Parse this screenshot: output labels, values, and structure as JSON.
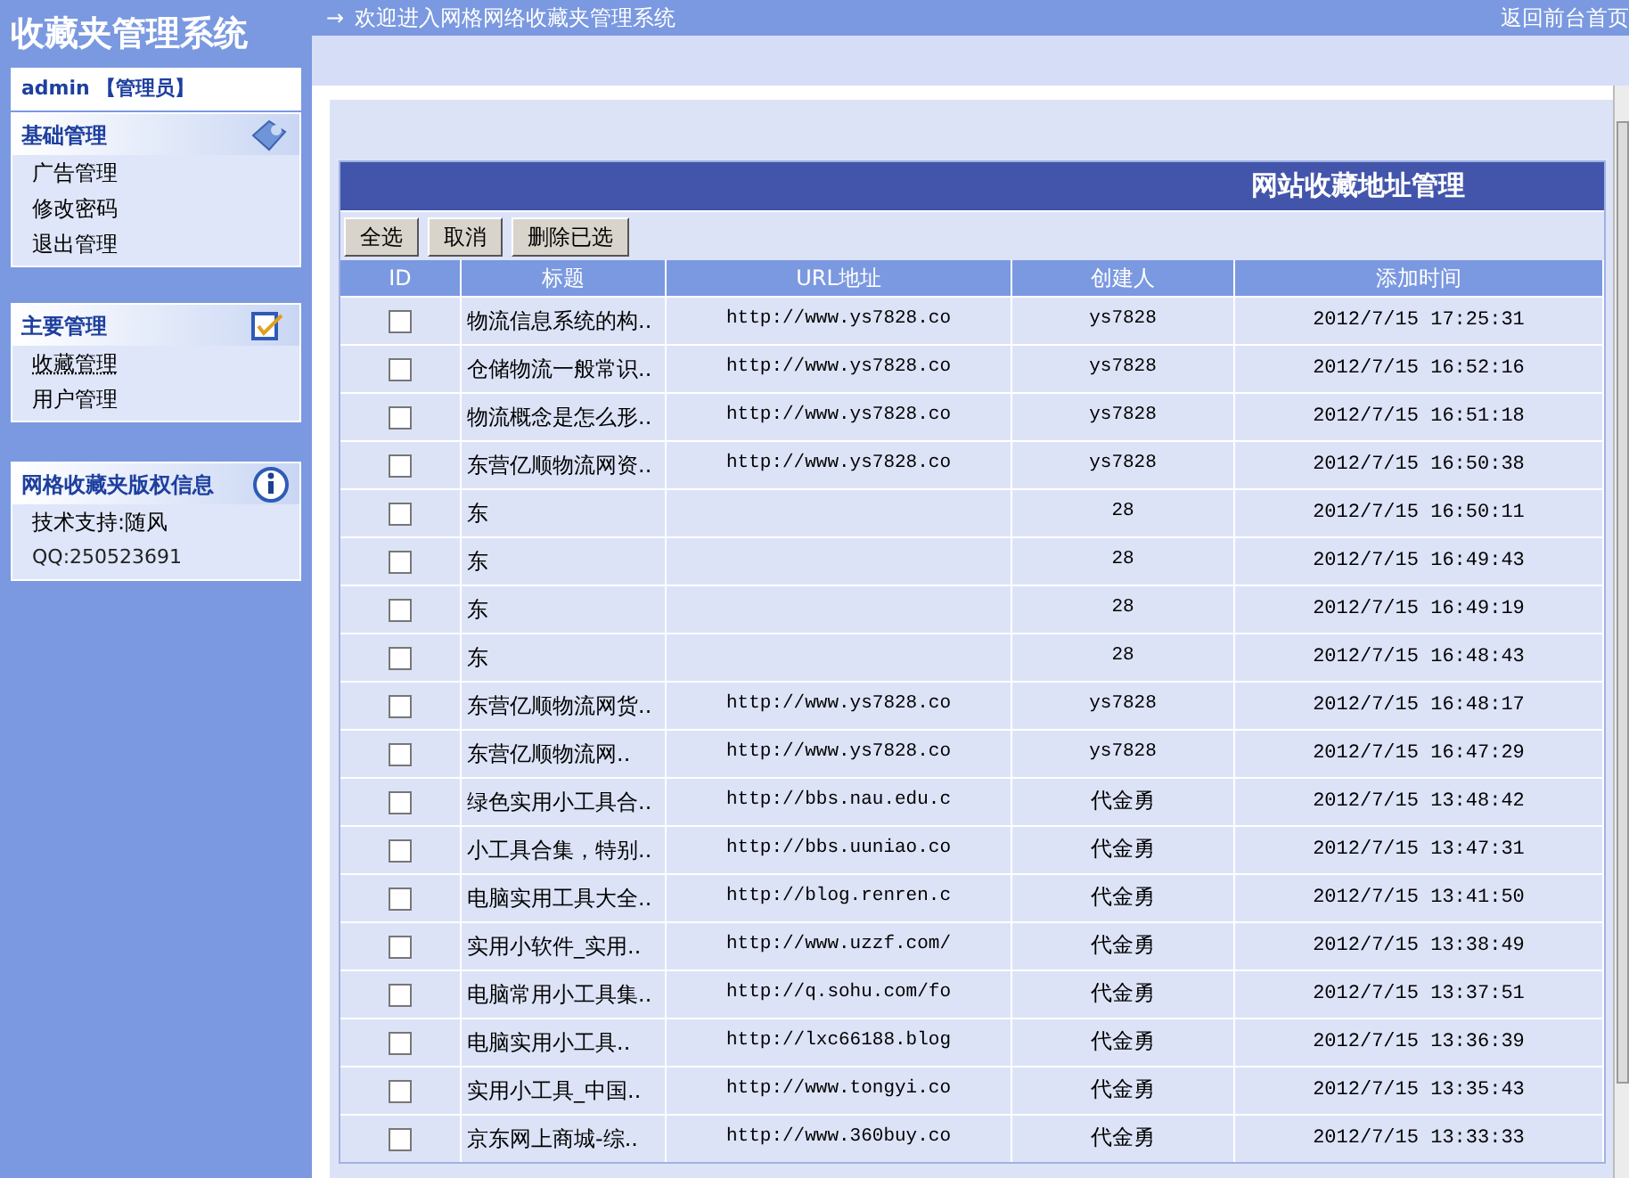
{
  "sidebar": {
    "title": "收藏夹管理系统",
    "user": "admin 【管理员】",
    "sections": [
      {
        "title": "基础管理",
        "items": [
          {
            "label": "广告管理",
            "selected": false
          },
          {
            "label": "修改密码",
            "selected": false
          },
          {
            "label": "退出管理",
            "selected": false
          }
        ]
      },
      {
        "title": "主要管理",
        "items": [
          {
            "label": "收藏管理",
            "selected": true
          },
          {
            "label": "用户管理",
            "selected": false
          }
        ]
      },
      {
        "title": "网格收藏夹版权信息",
        "items": [
          {
            "label": "技术支持:随风",
            "selected": false
          },
          {
            "label": "QQ:250523691",
            "selected": false
          }
        ]
      }
    ]
  },
  "top_bar": {
    "arrow": "→",
    "welcome": "欢迎进入网格网络收藏夹管理系统",
    "home_link": "返回前台首页"
  },
  "panel": {
    "title": "网站收藏地址管理",
    "buttons": [
      "全选",
      "取消",
      "删除已选"
    ],
    "table": {
      "columns": [
        "ID",
        "标题",
        "URL地址",
        "创建人",
        "添加时间"
      ],
      "rows": [
        {
          "checked": false,
          "title": "物流信息系统的构..",
          "url": "http://www.ys7828.co",
          "creator": "ys7828",
          "time": "2012/7/15 17:25:31"
        },
        {
          "checked": false,
          "title": "仓储物流一般常识..",
          "url": "http://www.ys7828.co",
          "creator": "ys7828",
          "time": "2012/7/15 16:52:16"
        },
        {
          "checked": false,
          "title": "物流概念是怎么形..",
          "url": "http://www.ys7828.co",
          "creator": "ys7828",
          "time": "2012/7/15 16:51:18"
        },
        {
          "checked": false,
          "title": "东营亿顺物流网资..",
          "url": "http://www.ys7828.co",
          "creator": "ys7828",
          "time": "2012/7/15 16:50:38"
        },
        {
          "checked": false,
          "title": "东",
          "creator": "28",
          "time": "2012/7/15 16:50:11"
        },
        {
          "checked": false,
          "title": "东",
          "creator": "28",
          "time": "2012/7/15 16:49:43"
        },
        {
          "checked": false,
          "title": "东",
          "creator": "28",
          "time": "2012/7/15 16:49:19"
        },
        {
          "checked": false,
          "title": "东",
          "creator": "28",
          "time": "2012/7/15 16:48:43"
        },
        {
          "checked": false,
          "title": "东营亿顺物流网货..",
          "url": "http://www.ys7828.co",
          "creator": "ys7828",
          "time": "2012/7/15 16:48:17"
        },
        {
          "checked": false,
          "title": "东营亿顺物流网..",
          "url": "http://www.ys7828.co",
          "creator": "ys7828",
          "time": "2012/7/15 16:47:29"
        },
        {
          "checked": false,
          "title": "绿色实用小工具合..",
          "url": "http://bbs.nau.edu.c",
          "creator": "代金勇",
          "time": "2012/7/15 13:48:42"
        },
        {
          "checked": false,
          "title": "小工具合集，特别..",
          "url": "http://bbs.uuniao.co",
          "creator": "代金勇",
          "time": "2012/7/15 13:47:31"
        },
        {
          "checked": false,
          "title": "电脑实用工具大全..",
          "url": "http://blog.renren.c",
          "creator": "代金勇",
          "time": "2012/7/15 13:41:50"
        },
        {
          "checked": false,
          "title": "实用小软件_实用..",
          "url": "http://www.uzzf.com/",
          "creator": "代金勇",
          "time": "2012/7/15 13:38:49"
        },
        {
          "checked": false,
          "title": "电脑常用小工具集..",
          "url": "http://q.sohu.com/fo",
          "creator": "代金勇",
          "time": "2012/7/15 13:37:51"
        },
        {
          "checked": false,
          "title": "电脑实用小工具..",
          "url": "http://lxc66188.blog",
          "creator": "代金勇",
          "time": "2012/7/15 13:36:39"
        },
        {
          "checked": false,
          "title": "实用小工具_中国..",
          "url": "http://www.tongyi.co",
          "creator": "代金勇",
          "time": "2012/7/15 13:35:43"
        },
        {
          "checked": false,
          "title": "京东网上商城-综..",
          "url": "http://www.360buy.co",
          "creator": "代金勇",
          "time": "2012/7/15 13:33:33"
        }
      ]
    }
  }
}
